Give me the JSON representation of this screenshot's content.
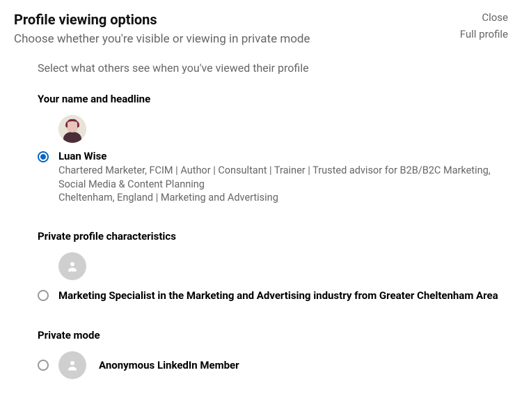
{
  "header": {
    "title": "Profile viewing options",
    "subtitle": "Choose whether you're visible or viewing in private mode",
    "close": "Close",
    "full_profile": "Full profile"
  },
  "instruction": "Select what others see when you've viewed their profile",
  "options": {
    "full": {
      "section_title": "Your name and headline",
      "name": "Luan Wise",
      "headline": "Chartered Marketer, FCIM | Author | Consultant | Trainer | Trusted advisor for B2B/B2C Marketing, Social Media & Content Planning",
      "location": "Cheltenham, England | Marketing and Advertising",
      "selected": true
    },
    "semi": {
      "section_title": "Private profile characteristics",
      "description": "Marketing Specialist in the Marketing and Advertising industry from Greater Cheltenham Area",
      "selected": false
    },
    "private": {
      "section_title": "Private mode",
      "label": "Anonymous LinkedIn Member",
      "selected": false
    }
  }
}
